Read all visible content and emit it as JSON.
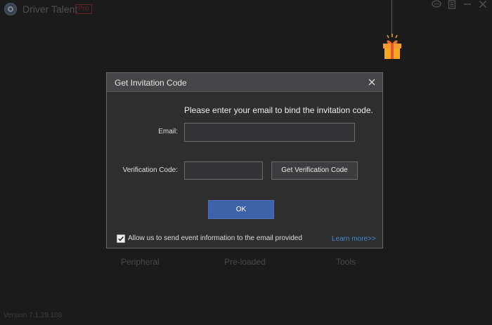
{
  "app": {
    "title": "Driver Talent",
    "badge": "Pro",
    "version": "Version 7.1.29.108"
  },
  "window_controls": {
    "feedback_icon": "chat-icon",
    "menu_icon": "menu-icon",
    "minimize_icon": "minimize-icon",
    "close_icon": "close-icon"
  },
  "background_features": [
    {
      "label": "Peripheral"
    },
    {
      "label": "Pre-loaded"
    },
    {
      "label": "Tools"
    }
  ],
  "dialog": {
    "title": "Get Invitation Code",
    "instruction": "Please enter your email to bind the invitation code.",
    "email_label": "Email:",
    "email_value": "",
    "verification_label": "Verification Code:",
    "verification_value": "",
    "get_code_button": "Get Verification Code",
    "ok_button": "OK",
    "consent_checked": true,
    "consent_text": "Allow us to send event information to the email provided",
    "learn_more": "Learn more>>"
  },
  "colors": {
    "background": "#1b1b1c",
    "dialog": "#2e2e2f",
    "header": "#454547",
    "ok_button": "#3d62a8",
    "link": "#3d8bd6",
    "gift": "#f5a623"
  }
}
